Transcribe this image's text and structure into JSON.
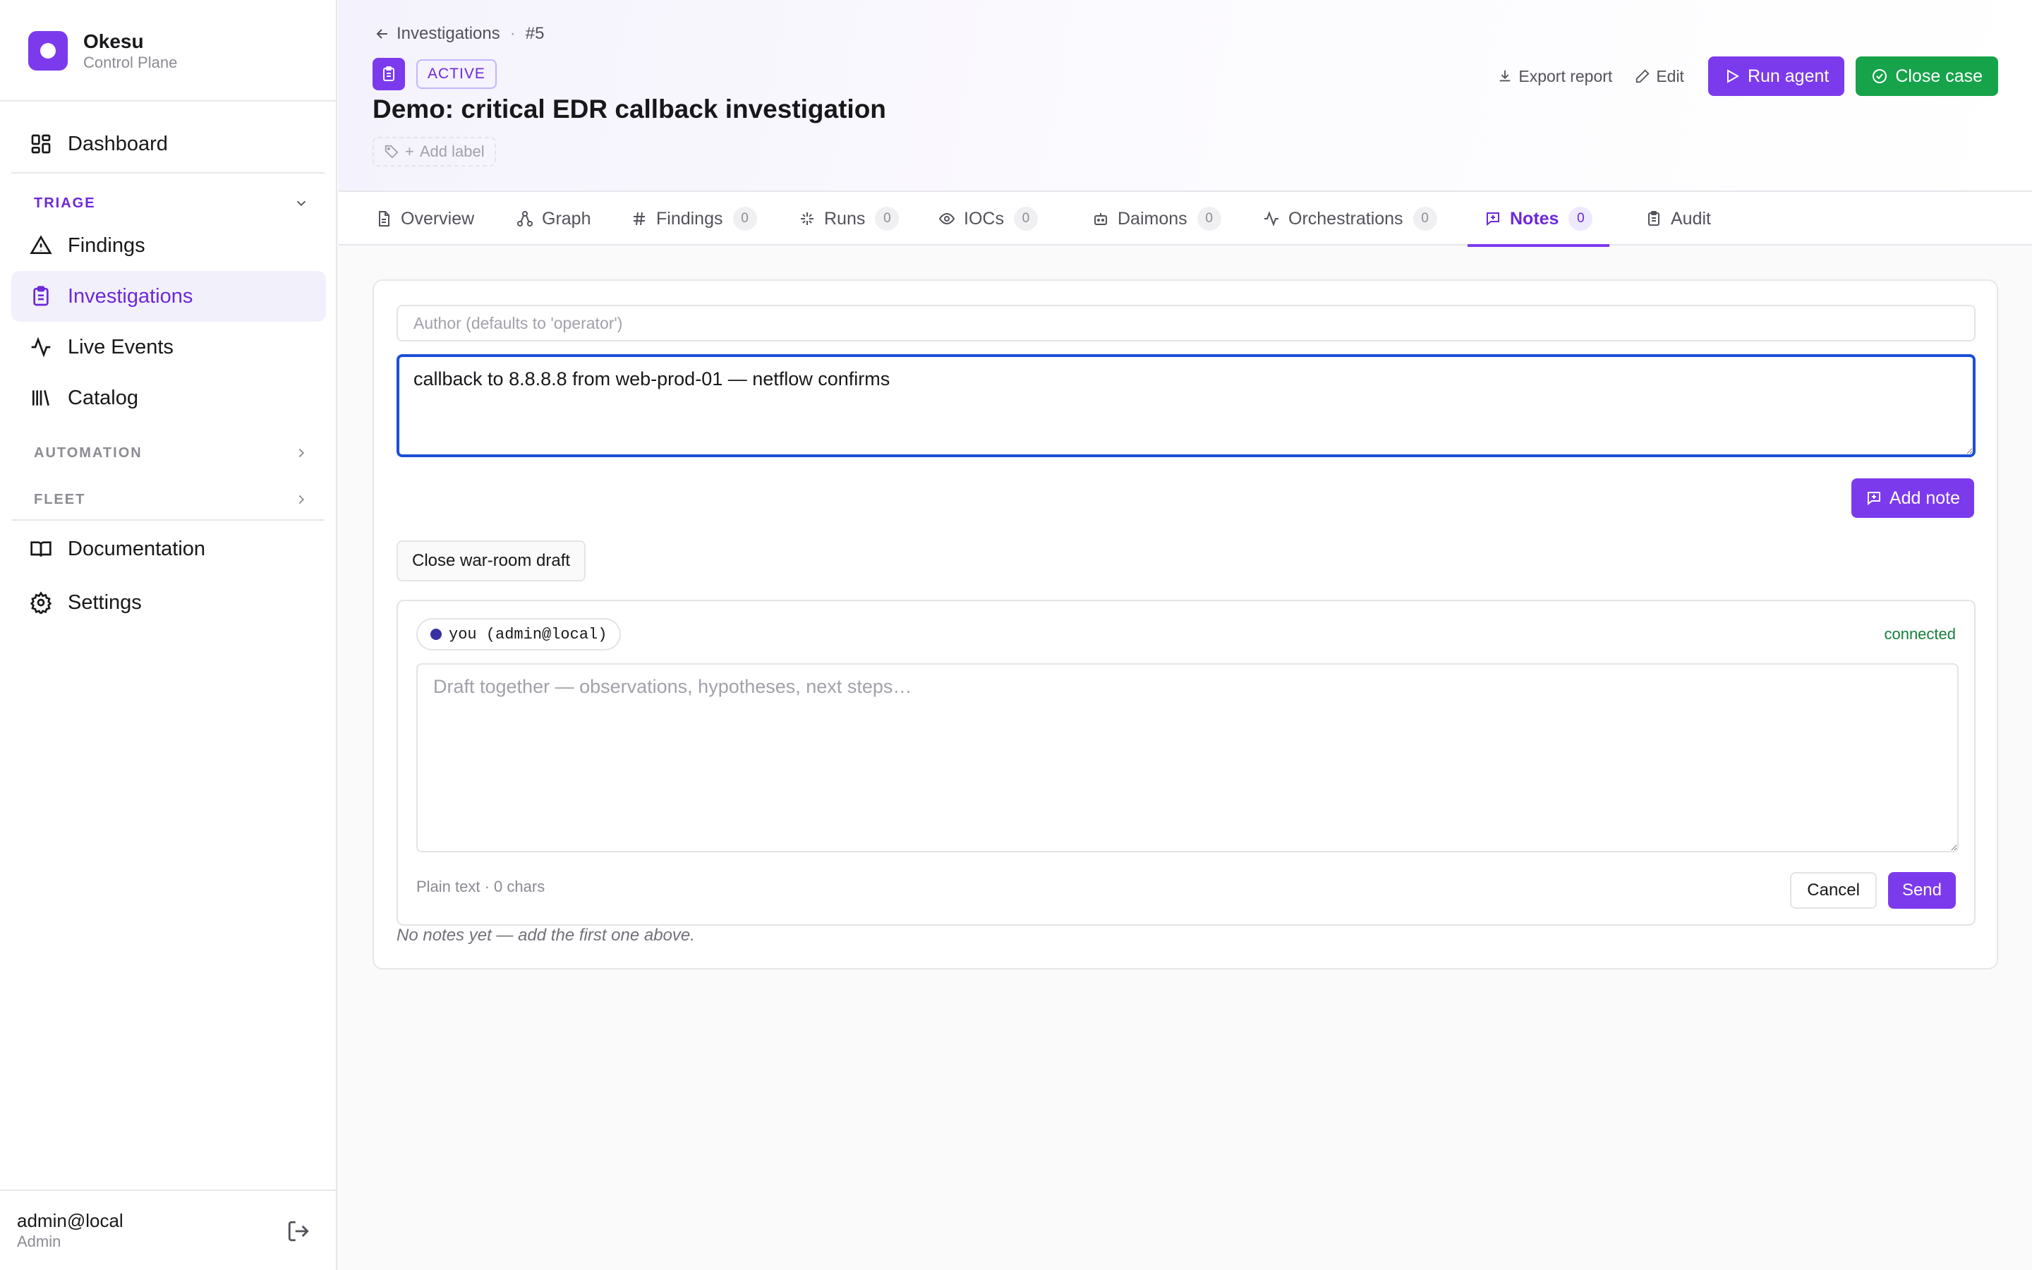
{
  "brand": {
    "name": "Okesu",
    "subtitle": "Control Plane",
    "accent": "#7c3aed"
  },
  "sidebar": {
    "dashboard": "Dashboard",
    "triage_section": "TRIAGE",
    "triage_items": [
      "Findings",
      "Investigations",
      "Live Events",
      "Catalog"
    ],
    "active_item": "Investigations",
    "automation_section": "AUTOMATION",
    "fleet_section": "FLEET",
    "documentation": "Documentation",
    "settings": "Settings",
    "user": {
      "name": "admin@local",
      "role": "Admin"
    }
  },
  "header": {
    "breadcrumb_parent": "Investigations",
    "breadcrumb_id": "#5",
    "status": "ACTIVE",
    "title": "Demo: critical EDR callback investigation",
    "add_label": "Add label",
    "actions": {
      "export": "Export report",
      "edit": "Edit",
      "run_agent": "Run agent",
      "close_case": "Close case"
    },
    "colors": {
      "run_agent": "#7c3aed",
      "close_case": "#16a34a"
    }
  },
  "tabs": [
    {
      "label": "Overview",
      "icon": "file-icon"
    },
    {
      "label": "Graph",
      "icon": "graph-icon"
    },
    {
      "label": "Findings",
      "icon": "hash-icon",
      "count": "0"
    },
    {
      "label": "Runs",
      "icon": "sparkle-icon",
      "count": "0"
    },
    {
      "label": "IOCs",
      "icon": "eye-icon",
      "count": "0"
    },
    {
      "label": "Daimons",
      "icon": "bot-icon",
      "count": "0"
    },
    {
      "label": "Orchestrations",
      "icon": "activity-icon",
      "count": "0"
    },
    {
      "label": "Notes",
      "icon": "message-icon",
      "count": "0"
    },
    {
      "label": "Audit",
      "icon": "clipboard-icon"
    }
  ],
  "active_tab": "Notes",
  "notes": {
    "author_placeholder": "Author (defaults to 'operator')",
    "author_value": "",
    "note_text": "callback to 8.8.8.8 from web-prod-01 — netflow confirms",
    "add_note": "Add note",
    "draft_toggle": "Close war-room draft",
    "warroom": {
      "presence_user": "you (admin@local)",
      "connection": "connected",
      "draft_placeholder": "Draft together — observations, hypotheses, next steps…",
      "meta": "Plain text · 0 chars",
      "cancel": "Cancel",
      "send": "Send"
    },
    "empty": "No notes yet — add the first one above."
  }
}
